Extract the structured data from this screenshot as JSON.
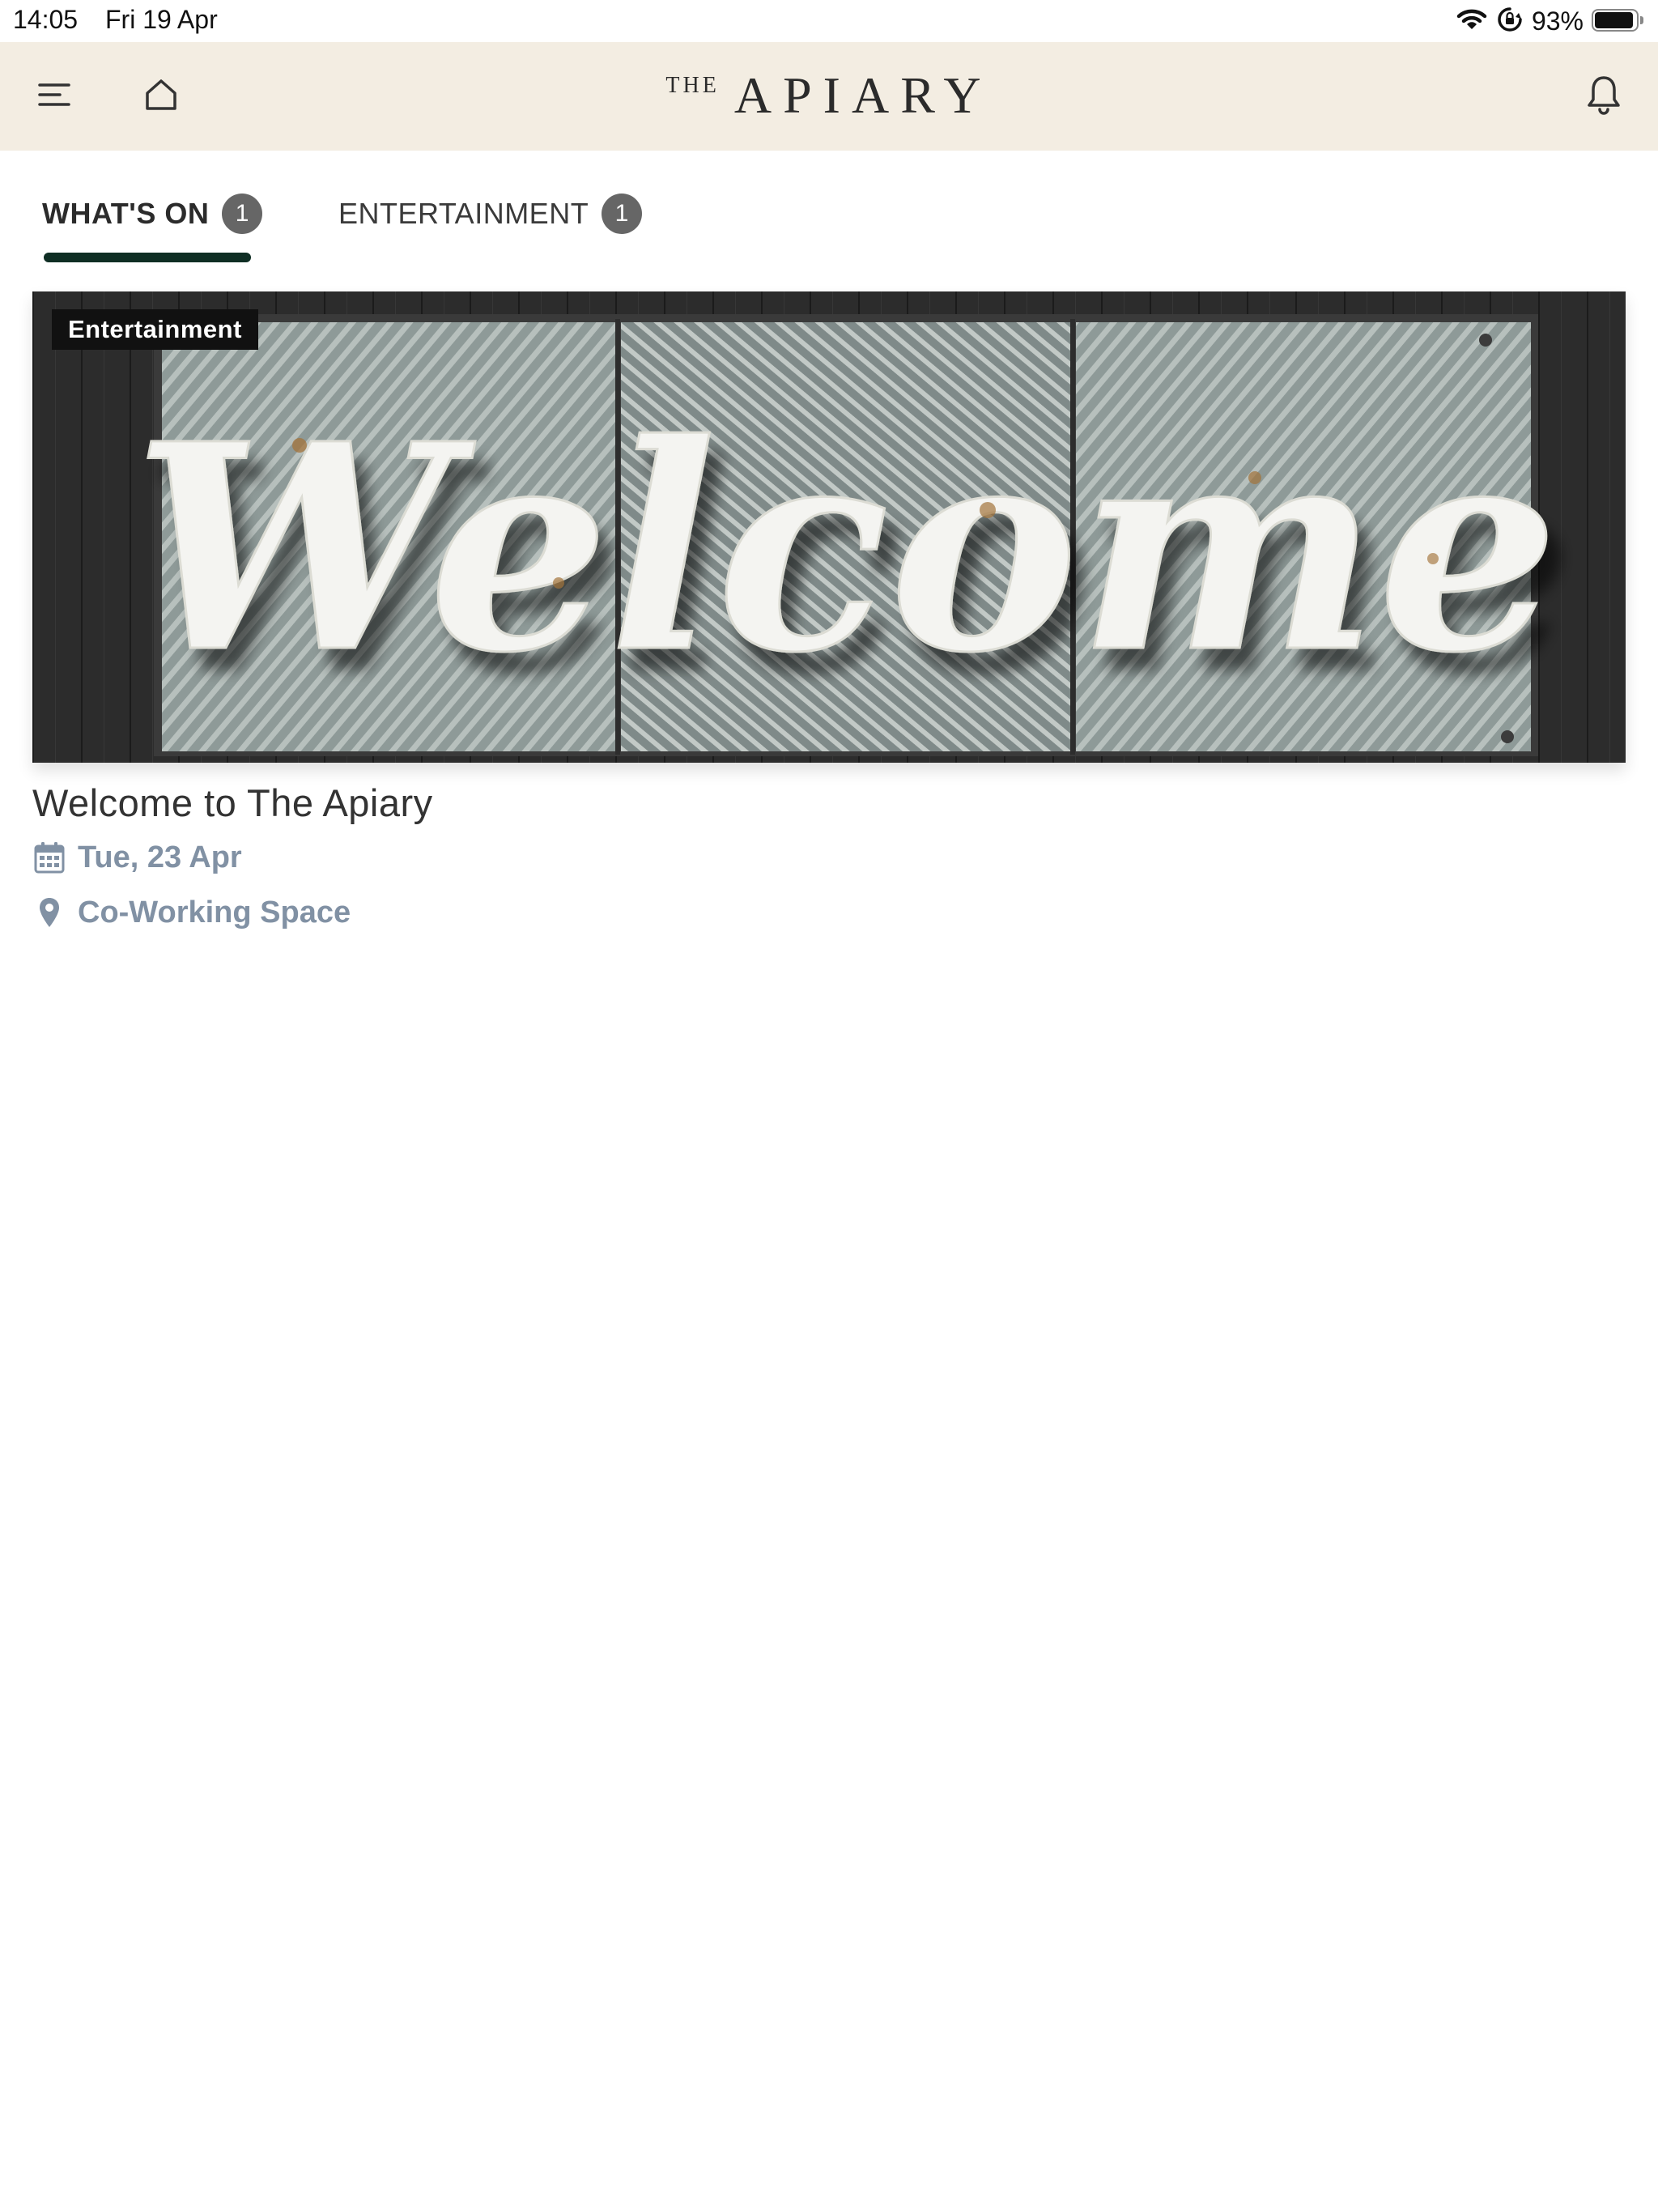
{
  "status_bar": {
    "time": "14:05",
    "date": "Fri 19 Apr",
    "battery_percent": "93%",
    "battery_level": 0.93
  },
  "header": {
    "logo_small": "THE",
    "logo_main": "APIARY",
    "background_color": "#f3ede2",
    "icons": [
      "menu-icon",
      "home-icon",
      "bell-icon"
    ]
  },
  "tabs": [
    {
      "label": "WHAT'S ON",
      "count": "1",
      "active": true
    },
    {
      "label": "ENTERTAINMENT",
      "count": "1",
      "active": false
    }
  ],
  "tab_indicator_color": "#0f2e24",
  "events": [
    {
      "category": "Entertainment",
      "image_sign_text": "Welcome",
      "title": "Welcome to The Apiary",
      "date": "Tue, 23 Apr",
      "location": "Co-Working Space",
      "meta_color": "#8191a4"
    }
  ]
}
